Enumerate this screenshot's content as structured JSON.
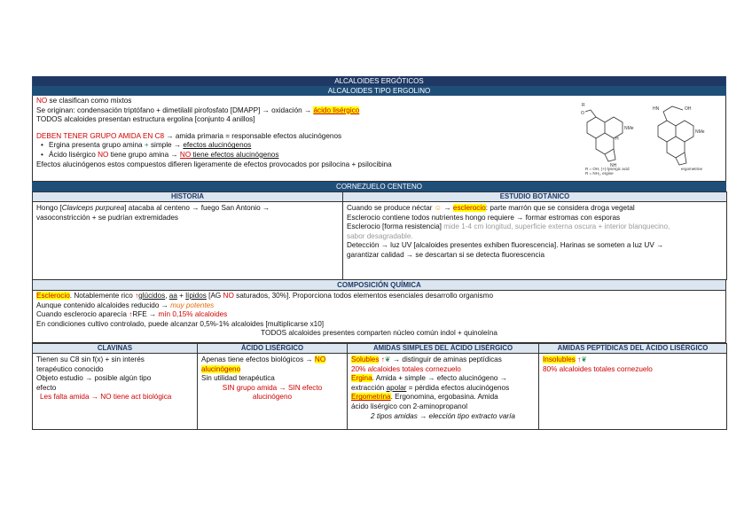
{
  "header": {
    "title": "ALCALOIDES ERGÓTICOS",
    "subtitle": "ALCALOIDES TIPO ERGOLINO"
  },
  "ergolino": {
    "l1_a": "NO",
    "l1_b": " se clasifican como mixtos",
    "l2_a": "Se originan: condensación triptófano + dimetilalil pirofosfato [DMAPP] → oxidación → ",
    "l2_b": "ácido lisérgico",
    "l3": "TODOS alcaloides presentan estructura ergolina [conjunto 4 anillos]",
    "l4_a": "DEBEN TENER GRUPO AMIDA EN C8",
    "l4_b": " → amida primaria = responsable efectos alucinógenos",
    "b1_a": "Ergina presenta grupo amina ",
    "b1_b": "+",
    "b1_c": " simple → ",
    "b1_d": "efectos alucinógenos",
    "b2_a": "Ácido lisérgico ",
    "b2_b": "NO",
    "b2_c": " tiene grupo amina → ",
    "b2_d": "NO",
    "b2_e": " tiene efectos alucinógenos",
    "l5": "Efectos alucinógenos estos compuestos difieren ligeramente de efectos provocados por psilocina + psilocibina",
    "structure_caption_1": "R = OH,  (+)-lysergic acid",
    "structure_caption_2": "R = NH₂,  ergine",
    "structure_caption_3": "ergometrine",
    "structure_label_nme": "NMe",
    "structure_label_h": "H",
    "structure_label_hn": "HN",
    "structure_label_oh": "OH",
    "structure_label_r": "R",
    "structure_label_nh": "NH",
    "structure_label_o": "O"
  },
  "cornezuelo": {
    "title": "CORNEZUELO CENTENO",
    "historia_header": "HISTORIA",
    "botanico_header": "ESTUDIO BOTÁNICO",
    "hist_a": "Hongo [",
    "hist_b": "Claviceps purpurea",
    "hist_c": "] atacaba al centeno → fuego San Antonio →",
    "hist_d": "vasoconstricción + se pudrían extremidades",
    "bot1_a": "Cuando se produce néctar ",
    "bot1_b": " → ",
    "bot1_c": "esclerocio",
    "bot1_d": ": parte marrón que se considera droga vegetal",
    "bot2": "Esclerocio contiene todos nutrientes hongo requiere → formar estromas con esporas",
    "bot3_a": "Esclerocio [forma resistencia] ",
    "bot3_b": "mide 1-4 cm longitud, superficie externa oscura + interior blanquecino,",
    "bot3_c": "sabor desagradable.",
    "bot4": "Detección → luz UV [alcaloides presentes exhiben fluorescencia]. Harinas se someten a luz UV →",
    "bot5": "garantizar calidad → se descartan si se detecta fluorescencia"
  },
  "composicion": {
    "title": "COMPOSICIÓN QUÍMICA",
    "c1_a": "Esclerocio",
    "c1_b": ". Notablemente rico ",
    "c1_c": "glúcidos",
    "c1_d": ", ",
    "c1_e": "aa",
    "c1_f": " + ",
    "c1_g": "lípidos",
    "c1_h": " [AG ",
    "c1_i": "NO",
    "c1_j": " saturados, 30%]. Proporciona todos elementos esenciales desarrollo organismo",
    "c2_a": "Aunque contenido alcaloides reducido → ",
    "c2_b": "muy potentes",
    "c3_a": "Cuando esclerocio aparecía ",
    "c3_b": "RFE → ",
    "c3_c": "mín 0,15% alcaloides",
    "c4": "En condiciones cultivo controlado, puede alcanzar 0,5%-1% alcaloides [multiplicarse x10]",
    "c5": "TODOS alcaloides presentes comparten núcleo común indol + quinoleína"
  },
  "tabla": {
    "headers": [
      "CLAVINAS",
      "ÁCIDO LISÉRGICO",
      "AMIDAS SIMPLES DEL ÁCIDO LISÉRGICO",
      "AMIDAS PEPTÍDICAS DEL ÁCIDO LISÉRGICO"
    ],
    "clav1": "Tienen su C8 sin f(x) + sin interés",
    "clav2": "terapéutico conocido",
    "clav3": "Objeto estudio → posible algún tipo",
    "clav4": "efecto",
    "clav5": "Les falta amida → NO tiene act biológica",
    "ac1_a": "Apenas tiene efectos biológicos → ",
    "ac1_b": "NO",
    "ac2": "alucinógeno",
    "ac3": "Sin utilidad terapéutica",
    "ac4": "SIN grupo amida → SIN efecto",
    "ac5": "alucinógeno",
    "am1_a": "Solubles",
    "am1_b": " → distinguir de aminas peptídicas",
    "am2": "20% alcaloides totales cornezuelo",
    "am3_a": "Ergina",
    "am3_b": ". Amida + simple → efecto alucinógeno →",
    "am4_a": "extracción ",
    "am4_b": "apolar",
    "am4_c": " = pérdida efectos alucinógenos",
    "am5_a": "Ergometrina",
    "am5_b": ". Ergonomina, ergobasina. Amida",
    "am6": "ácido lisérgico con 2-aminopropanol",
    "am7": "2 tipos amidas → elección tipo extracto varía",
    "pep1": "Insolubles",
    "pep2": "80% alcaloides totales cornezuelo"
  },
  "icons": {
    "pin": "↑",
    "leaf": "❦",
    "sun": "☺"
  }
}
